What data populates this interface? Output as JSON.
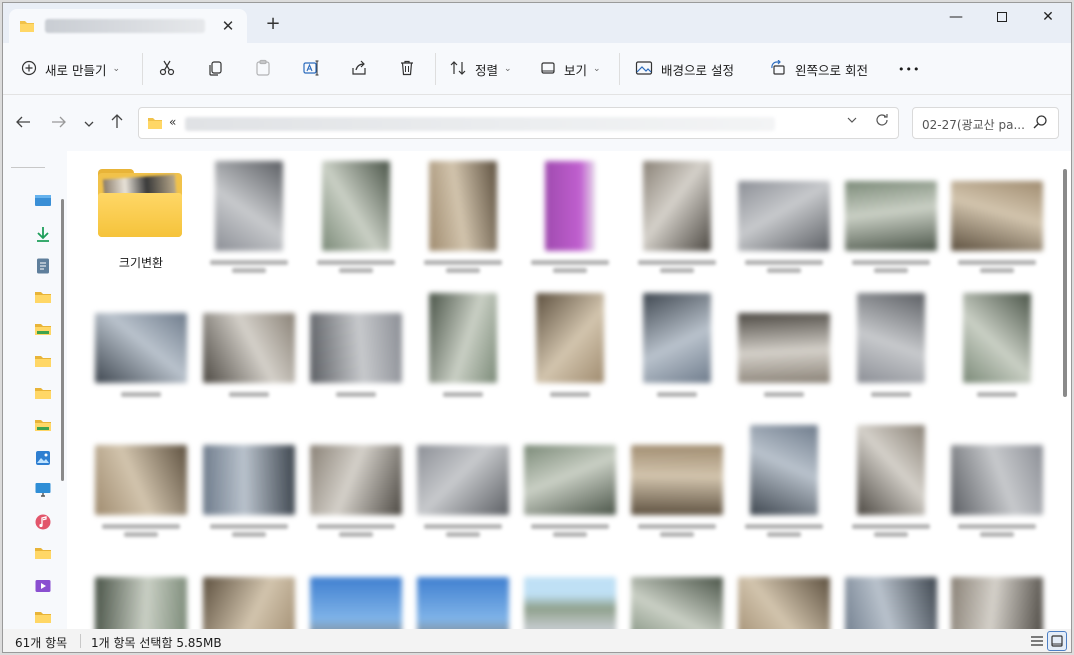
{
  "tab": {
    "close_label": "✕",
    "new_tab_label": "+"
  },
  "window_controls": {
    "minimize": "—",
    "close": "✕"
  },
  "toolbar": {
    "new_label": "새로 만들기",
    "sort_label": "정렬",
    "view_label": "보기",
    "set_background_label": "배경으로 설정",
    "rotate_left_label": "왼쪽으로 회전",
    "more_label": "•••"
  },
  "address": {
    "prefix": "«"
  },
  "search": {
    "placeholder": "02-27(광교산 pa..."
  },
  "folder": {
    "name": "크기변환"
  },
  "status": {
    "item_count": "61개 항목",
    "selection": "1개 항목 선택함 5.85MB"
  },
  "colors": {
    "folder": "#f1c24a",
    "accent": "#4d7fc4"
  }
}
